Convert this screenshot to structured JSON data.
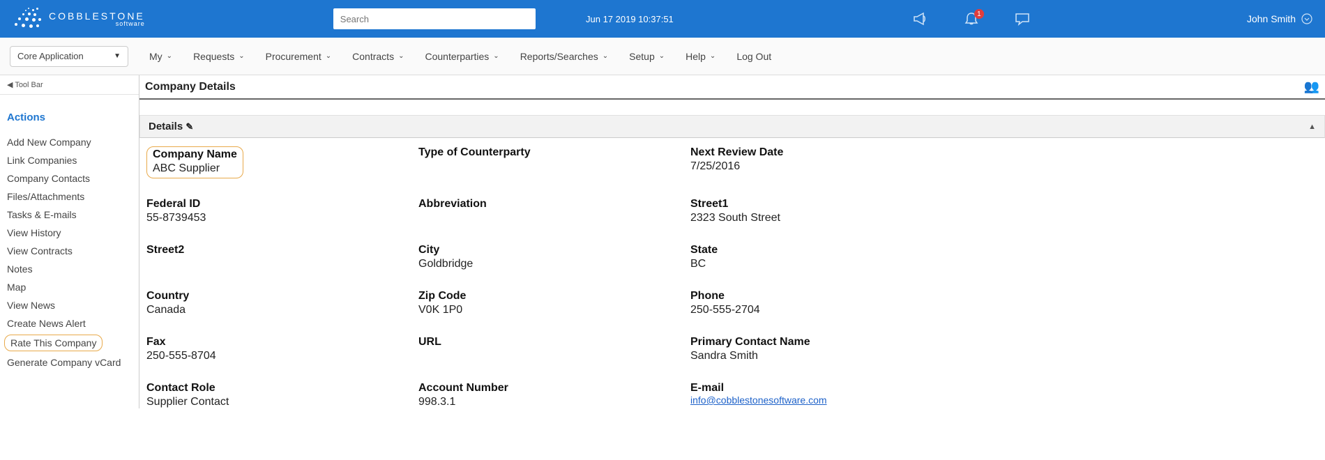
{
  "header": {
    "logo_main": "COBBLESTONE",
    "logo_sub": "software",
    "search_placeholder": "Search",
    "timestamp": "Jun 17 2019 10:37:51",
    "notification_count": "1",
    "user_name": "John Smith"
  },
  "menu": {
    "app_selector": "Core Application",
    "items": [
      "My",
      "Requests",
      "Procurement",
      "Contracts",
      "Counterparties",
      "Reports/Searches",
      "Setup",
      "Help",
      "Log Out"
    ]
  },
  "sidebar": {
    "toolbar_toggle": "◀ Tool Bar",
    "title": "Actions",
    "links": [
      "Add New Company",
      "Link Companies",
      "Company Contacts",
      "Files/Attachments",
      "Tasks & E-mails",
      "View History",
      "View Contracts",
      "Notes",
      "Map",
      "View News",
      "Create News Alert",
      "Rate This Company",
      "Generate Company vCard"
    ]
  },
  "page": {
    "title": "Company Details",
    "panel_title": "Details"
  },
  "details": {
    "company_name_label": "Company Name",
    "company_name_value": "ABC Supplier",
    "type_label": "Type of Counterparty",
    "type_value": "",
    "next_review_label": "Next Review Date",
    "next_review_value": "7/25/2016",
    "federal_id_label": "Federal ID",
    "federal_id_value": "55-8739453",
    "abbreviation_label": "Abbreviation",
    "abbreviation_value": "",
    "street1_label": "Street1",
    "street1_value": "2323 South Street",
    "street2_label": "Street2",
    "street2_value": "",
    "city_label": "City",
    "city_value": "Goldbridge",
    "state_label": "State",
    "state_value": "BC",
    "country_label": "Country",
    "country_value": "Canada",
    "zip_label": "Zip Code",
    "zip_value": "V0K 1P0",
    "phone_label": "Phone",
    "phone_value": "250-555-2704",
    "fax_label": "Fax",
    "fax_value": "250-555-8704",
    "url_label": "URL",
    "url_value": "",
    "primary_contact_label": "Primary Contact Name",
    "primary_contact_value": "Sandra Smith",
    "contact_role_label": "Contact Role",
    "contact_role_value": "Supplier Contact",
    "account_number_label": "Account Number",
    "account_number_value": "998.3.1",
    "email_label": "E-mail",
    "email_value": "info@cobblestonesoftware.com"
  }
}
